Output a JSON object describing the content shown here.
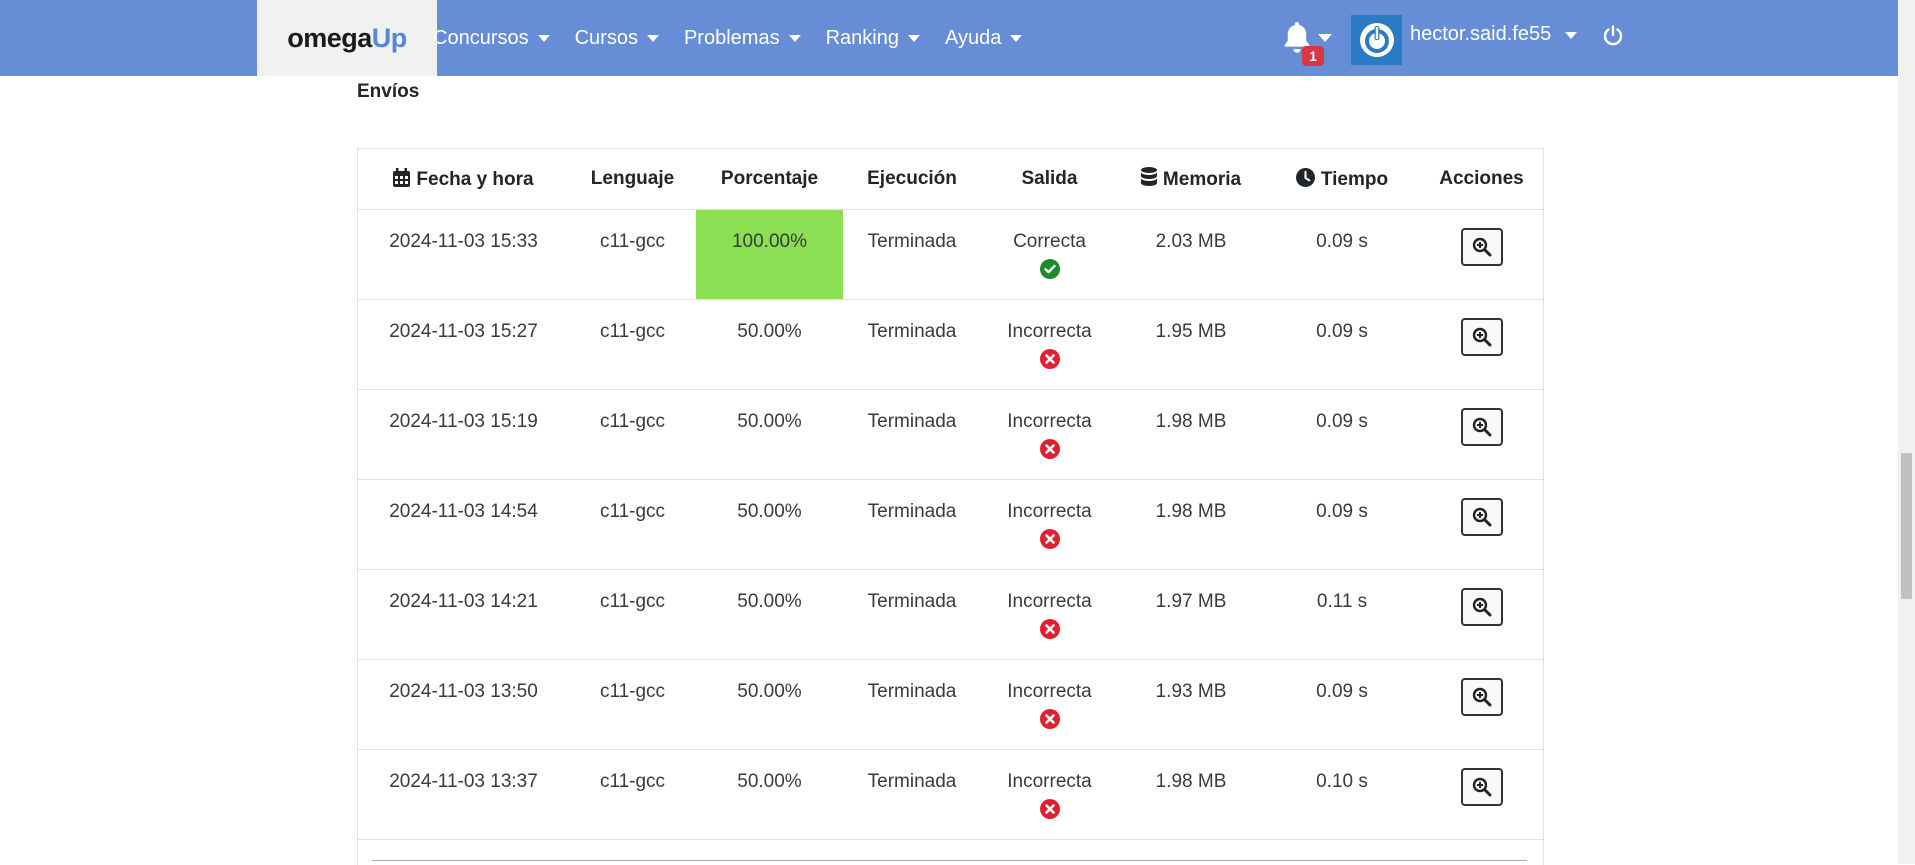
{
  "brand": {
    "part1": "omega",
    "part2": "Up"
  },
  "nav": {
    "items": [
      {
        "label": "Concursos"
      },
      {
        "label": "Cursos"
      },
      {
        "label": "Problemas"
      },
      {
        "label": "Ranking"
      },
      {
        "label": "Ayuda"
      }
    ],
    "notifications_count": "1",
    "username": "hector.said.fe55"
  },
  "section_title": "Envíos",
  "table": {
    "headers": {
      "datetime": "Fecha y hora",
      "language": "Lenguaje",
      "percentage": "Porcentaje",
      "execution": "Ejecución",
      "output": "Salida",
      "memory": "Memoria",
      "time": "Tiempo",
      "actions": "Acciones"
    },
    "rows": [
      {
        "datetime": "2024-11-03 15:33",
        "language": "c11-gcc",
        "percentage": "100.00%",
        "execution": "Terminada",
        "output": "Correcta",
        "memory": "2.03 MB",
        "time": "0.09 s"
      },
      {
        "datetime": "2024-11-03 15:27",
        "language": "c11-gcc",
        "percentage": "50.00%",
        "execution": "Terminada",
        "output": "Incorrecta",
        "memory": "1.95 MB",
        "time": "0.09 s"
      },
      {
        "datetime": "2024-11-03 15:19",
        "language": "c11-gcc",
        "percentage": "50.00%",
        "execution": "Terminada",
        "output": "Incorrecta",
        "memory": "1.98 MB",
        "time": "0.09 s"
      },
      {
        "datetime": "2024-11-03 14:54",
        "language": "c11-gcc",
        "percentage": "50.00%",
        "execution": "Terminada",
        "output": "Incorrecta",
        "memory": "1.98 MB",
        "time": "0.09 s"
      },
      {
        "datetime": "2024-11-03 14:21",
        "language": "c11-gcc",
        "percentage": "50.00%",
        "execution": "Terminada",
        "output": "Incorrecta",
        "memory": "1.97 MB",
        "time": "0.11 s"
      },
      {
        "datetime": "2024-11-03 13:50",
        "language": "c11-gcc",
        "percentage": "50.00%",
        "execution": "Terminada",
        "output": "Incorrecta",
        "memory": "1.93 MB",
        "time": "0.09 s"
      },
      {
        "datetime": "2024-11-03 13:37",
        "language": "c11-gcc",
        "percentage": "50.00%",
        "execution": "Terminada",
        "output": "Incorrecta",
        "memory": "1.98 MB",
        "time": "0.10 s"
      }
    ]
  },
  "colors": {
    "navbar": "#678dd7",
    "full_score": "#8ae052",
    "correct": "#1e8a2e",
    "incorrect": "#e0202e",
    "badge": "#dc3545"
  }
}
